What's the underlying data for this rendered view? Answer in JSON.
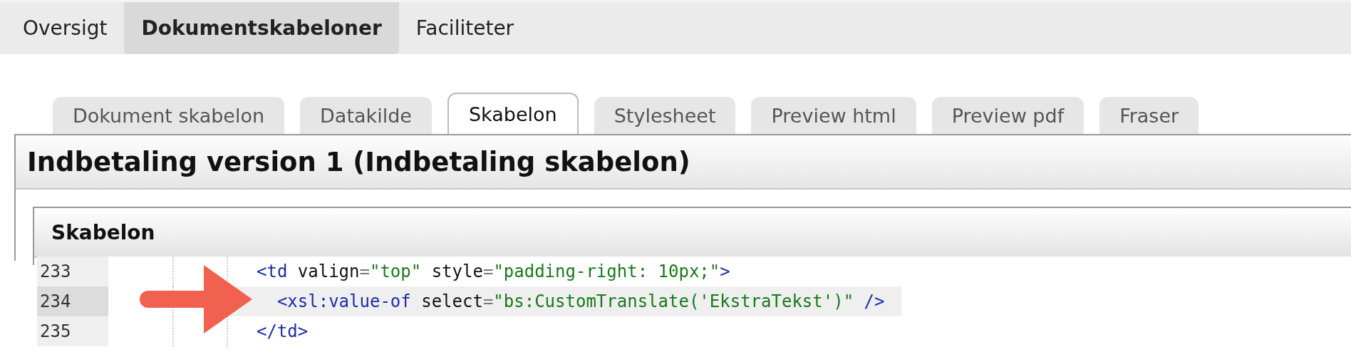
{
  "nav": [
    {
      "label": "Oversigt",
      "selected": false
    },
    {
      "label": "Dokumentskabeloner",
      "selected": true
    },
    {
      "label": "Faciliteter",
      "selected": false
    }
  ],
  "tabs": [
    {
      "label": "Dokument skabelon",
      "selected": false
    },
    {
      "label": "Datakilde",
      "selected": false
    },
    {
      "label": "Skabelon",
      "selected": true
    },
    {
      "label": "Stylesheet",
      "selected": false
    },
    {
      "label": "Preview html",
      "selected": false
    },
    {
      "label": "Preview pdf",
      "selected": false
    },
    {
      "label": "Fraser",
      "selected": false
    }
  ],
  "panel": {
    "title": "Indbetaling version 1 (Indbetaling skabelon)",
    "section": "Skabelon"
  },
  "code": {
    "lines": [
      {
        "number": "233",
        "highlighted": false,
        "tokens": [
          {
            "kind": "tag",
            "text": "<td"
          },
          {
            "kind": "attr",
            "text": " valign"
          },
          {
            "kind": "punct",
            "text": "="
          },
          {
            "kind": "string",
            "text": "\"top\""
          },
          {
            "kind": "attr",
            "text": " style"
          },
          {
            "kind": "punct",
            "text": "="
          },
          {
            "kind": "string",
            "text": "\"padding-right: 10px;\""
          },
          {
            "kind": "tag",
            "text": ">"
          }
        ]
      },
      {
        "number": "234",
        "highlighted": true,
        "tokens": [
          {
            "kind": "tag",
            "text": "  <xsl:value-of"
          },
          {
            "kind": "attr",
            "text": " select"
          },
          {
            "kind": "punct",
            "text": "="
          },
          {
            "kind": "string",
            "text": "\"bs:CustomTranslate('EkstraTekst')\""
          },
          {
            "kind": "tag",
            "text": " />"
          }
        ]
      },
      {
        "number": "235",
        "highlighted": false,
        "tokens": [
          {
            "kind": "tag",
            "text": "</td>"
          }
        ]
      }
    ]
  }
}
